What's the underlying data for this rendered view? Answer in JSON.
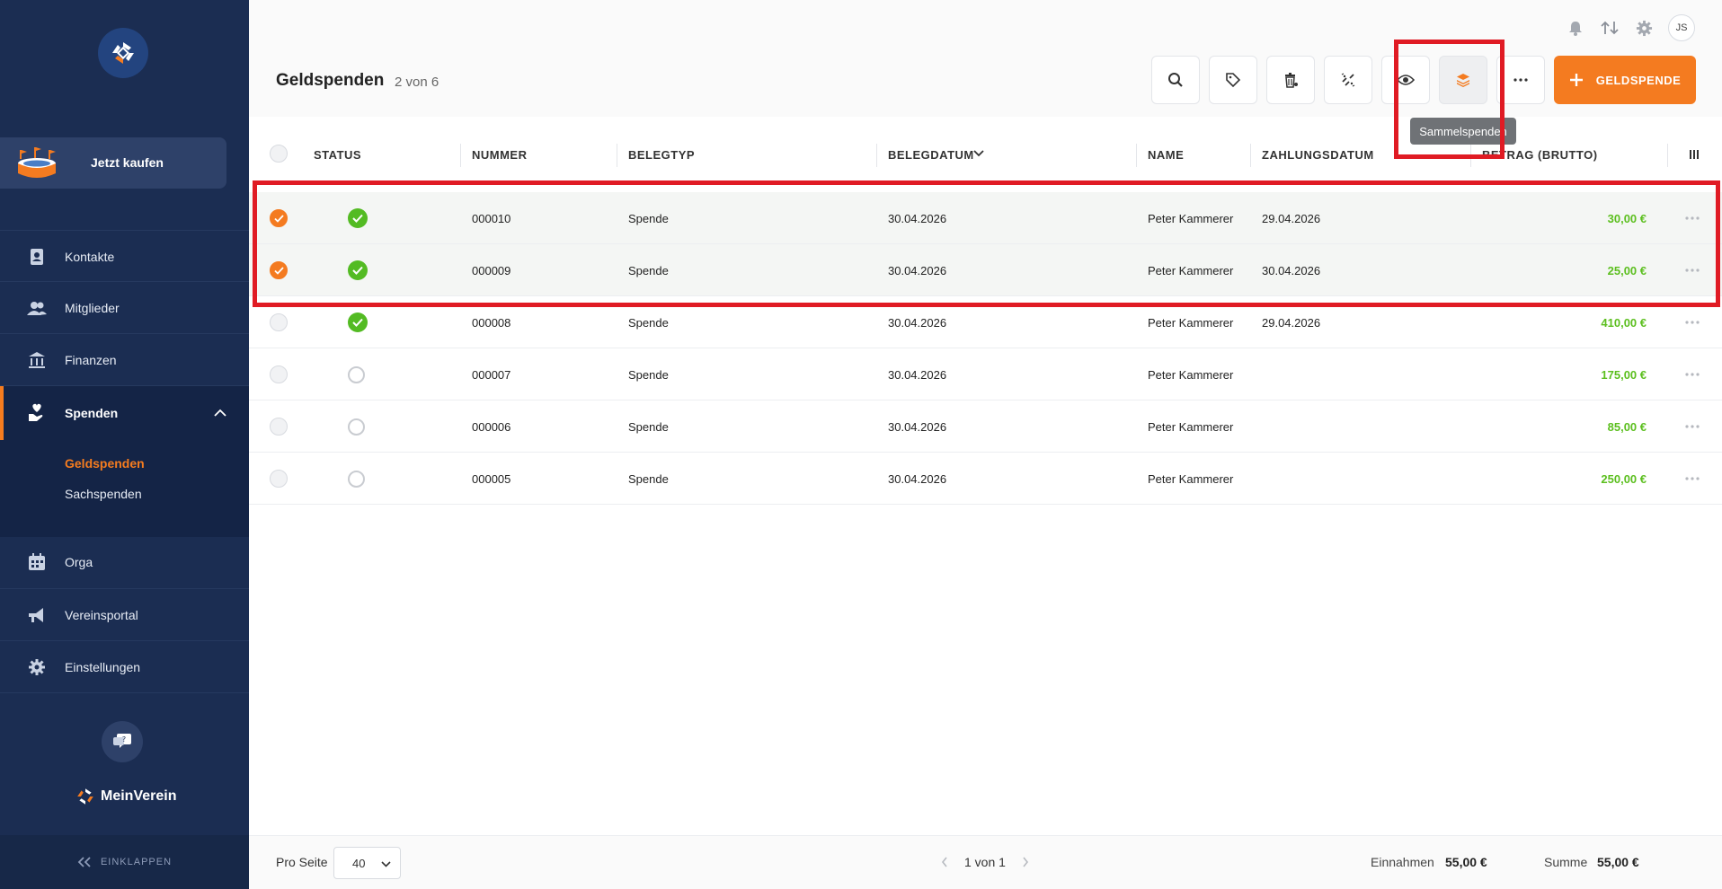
{
  "sidebar": {
    "buy_label": "Jetzt kaufen",
    "nav": [
      {
        "label": "Kontakte",
        "icon": "contact-book-icon"
      },
      {
        "label": "Mitglieder",
        "icon": "members-icon"
      },
      {
        "label": "Finanzen",
        "icon": "bank-icon"
      },
      {
        "label": "Spenden",
        "icon": "donation-hand-icon",
        "active": true
      },
      {
        "label": "Orga",
        "icon": "calendar-icon"
      },
      {
        "label": "Vereinsportal",
        "icon": "megaphone-icon"
      },
      {
        "label": "Einstellungen",
        "icon": "gear-icon"
      }
    ],
    "sub": [
      {
        "label": "Geldspenden",
        "active": true
      },
      {
        "label": "Sachspenden"
      }
    ],
    "brand": "MeinVerein",
    "collapse_label": "EINKLAPPEN"
  },
  "header": {
    "title": "Geldspenden",
    "count": "2 von 6",
    "avatar": "JS",
    "add_button": "GELDSPENDE",
    "tooltip": "Sammelspenden"
  },
  "table": {
    "columns": [
      "STATUS",
      "NUMMER",
      "BELEGTYP",
      "BELEGDATUM",
      "NAME",
      "ZAHLUNGSDATUM",
      "BETRAG (BRUTTO)"
    ],
    "rows": [
      {
        "selected": true,
        "status": "paid",
        "nummer": "000010",
        "belegtyp": "Spende",
        "belegdatum": "30.04.2026",
        "name": "Peter Kammerer",
        "zahlungsdatum": "29.04.2026",
        "betrag": "30,00 €"
      },
      {
        "selected": true,
        "status": "paid",
        "nummer": "000009",
        "belegtyp": "Spende",
        "belegdatum": "30.04.2026",
        "name": "Peter Kammerer",
        "zahlungsdatum": "30.04.2026",
        "betrag": "25,00 €"
      },
      {
        "selected": false,
        "status": "paid",
        "nummer": "000008",
        "belegtyp": "Spende",
        "belegdatum": "30.04.2026",
        "name": "Peter Kammerer",
        "zahlungsdatum": "29.04.2026",
        "betrag": "410,00 €"
      },
      {
        "selected": false,
        "status": "open",
        "nummer": "000007",
        "belegtyp": "Spende",
        "belegdatum": "30.04.2026",
        "name": "Peter Kammerer",
        "zahlungsdatum": "",
        "betrag": "175,00 €"
      },
      {
        "selected": false,
        "status": "open",
        "nummer": "000006",
        "belegtyp": "Spende",
        "belegdatum": "30.04.2026",
        "name": "Peter Kammerer",
        "zahlungsdatum": "",
        "betrag": "85,00 €"
      },
      {
        "selected": false,
        "status": "open",
        "nummer": "000005",
        "belegtyp": "Spende",
        "belegdatum": "30.04.2026",
        "name": "Peter Kammerer",
        "zahlungsdatum": "",
        "betrag": "250,00 €"
      }
    ]
  },
  "footer": {
    "per_page_label": "Pro Seite",
    "per_page_value": "40",
    "pager": "1 von 1",
    "einnahmen_label": "Einnahmen",
    "einnahmen_value": "55,00 €",
    "summe_label": "Summe",
    "summe_value": "55,00 €"
  },
  "colors": {
    "sidebar_bg": "#1b2d52",
    "accent": "#f47b20",
    "amount_green": "#5cbf1f",
    "status_green": "#53bb23",
    "highlight_red": "#e01b24"
  }
}
